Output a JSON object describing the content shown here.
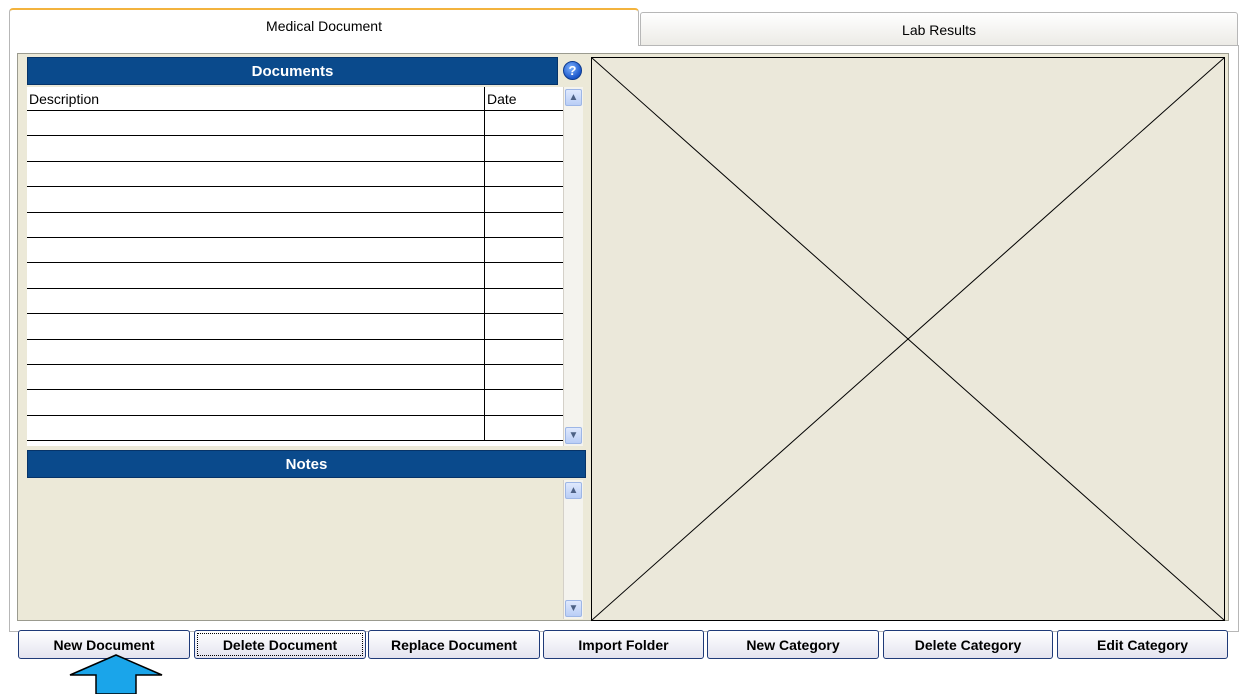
{
  "tabs": [
    {
      "label": "Medical Document",
      "active": true
    },
    {
      "label": "Lab Results",
      "active": false
    }
  ],
  "documents": {
    "title": "Documents",
    "columns": {
      "description": "Description",
      "date": "Date"
    },
    "row_count": 13,
    "help_icon": "question-circle-icon"
  },
  "notes": {
    "title": "Notes"
  },
  "buttons": {
    "new_document": "New Document",
    "delete_document": "Delete Document",
    "replace_document": "Replace Document",
    "import_folder": "Import Folder",
    "new_category": "New Category",
    "delete_category": "Delete Category",
    "edit_category": "Edit Category"
  },
  "colors": {
    "header_blue": "#0a4a8c",
    "active_tab_accent": "#f3b33d",
    "panel_beige": "#ece9d8",
    "arrow_blue": "#1aa5ea"
  }
}
